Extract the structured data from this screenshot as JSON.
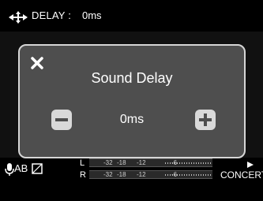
{
  "status": {
    "delay_label": "DELAY :",
    "delay_value": "0ms",
    "delay_icon": "left-right-arrows-icon"
  },
  "dialog": {
    "close_icon": "close-icon",
    "title": "Sound Delay",
    "value": "0ms",
    "decrease_icon": "minus-icon",
    "increase_icon": "plus-icon"
  },
  "bottom": {
    "mic_icon": "microphone-icon",
    "ab_label": "AB",
    "box_icon": "square-icon",
    "meter": {
      "channels": [
        {
          "label": "L",
          "ticks": [
            "-32",
            "-18",
            "-12",
            "-6"
          ]
        },
        {
          "label": "R",
          "ticks": [
            "-32",
            "-18",
            "-12",
            "-6"
          ]
        }
      ]
    },
    "play_icon": "play-icon",
    "mode_label": "CONCERT"
  },
  "colors": {
    "background": "#000000",
    "dialog_bg": "#4e4e4e",
    "dialog_border": "#d6d6d6",
    "button_bg": "#d9d9d9"
  }
}
